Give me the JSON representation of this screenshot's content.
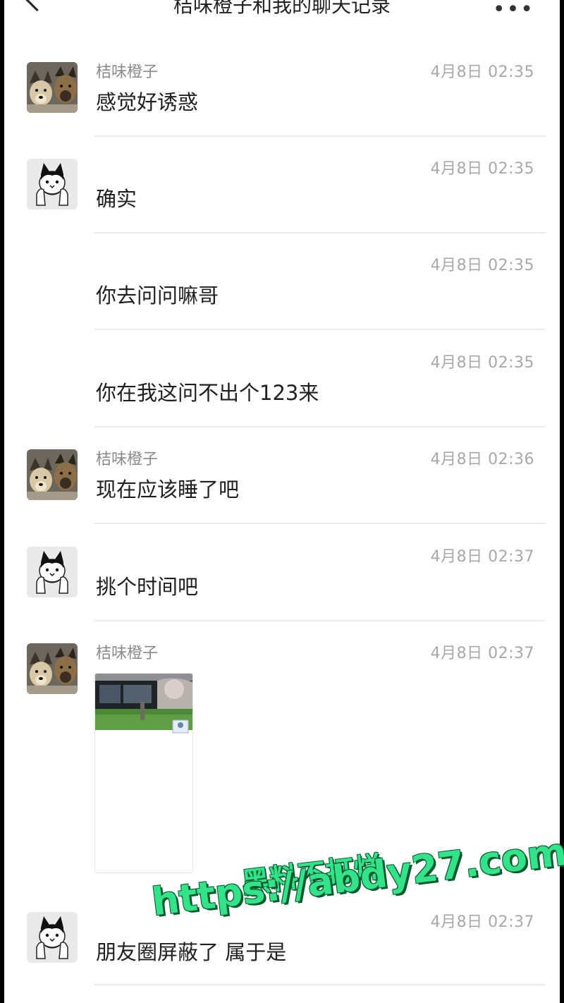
{
  "header": {
    "title": "桔味橙子和我的聊天记录",
    "back_icon": "back-chevron-icon",
    "more_icon": "more-icon"
  },
  "messages": [
    {
      "sender": "桔味橙子",
      "avatar": "dogs-avatar",
      "time": "4月8日 02:35",
      "text": "感觉好诱惑"
    },
    {
      "sender": "",
      "avatar": "cat-avatar",
      "time": "4月8日 02:35",
      "text": "确实"
    },
    {
      "sender": "",
      "avatar": "",
      "time": "4月8日 02:35",
      "text": "你去问问嘛哥"
    },
    {
      "sender": "",
      "avatar": "",
      "time": "4月8日 02:35",
      "text": "你在我这问不出个123来"
    },
    {
      "sender": "桔味橙子",
      "avatar": "dogs-avatar",
      "time": "4月8日 02:36",
      "text": "现在应该睡了吧"
    },
    {
      "sender": "",
      "avatar": "cat-avatar",
      "time": "4月8日 02:37",
      "text": "挑个时间吧"
    },
    {
      "sender": "桔味橙子",
      "avatar": "dogs-avatar",
      "time": "4月8日 02:37",
      "text": ""
    },
    {
      "sender": "",
      "avatar": "cat-avatar",
      "time": "4月8日 02:37",
      "text": "朋友圈屏蔽了 属于是"
    }
  ],
  "watermark": {
    "line1": "黑料不打烊",
    "line2": "https://abdy27.com"
  }
}
